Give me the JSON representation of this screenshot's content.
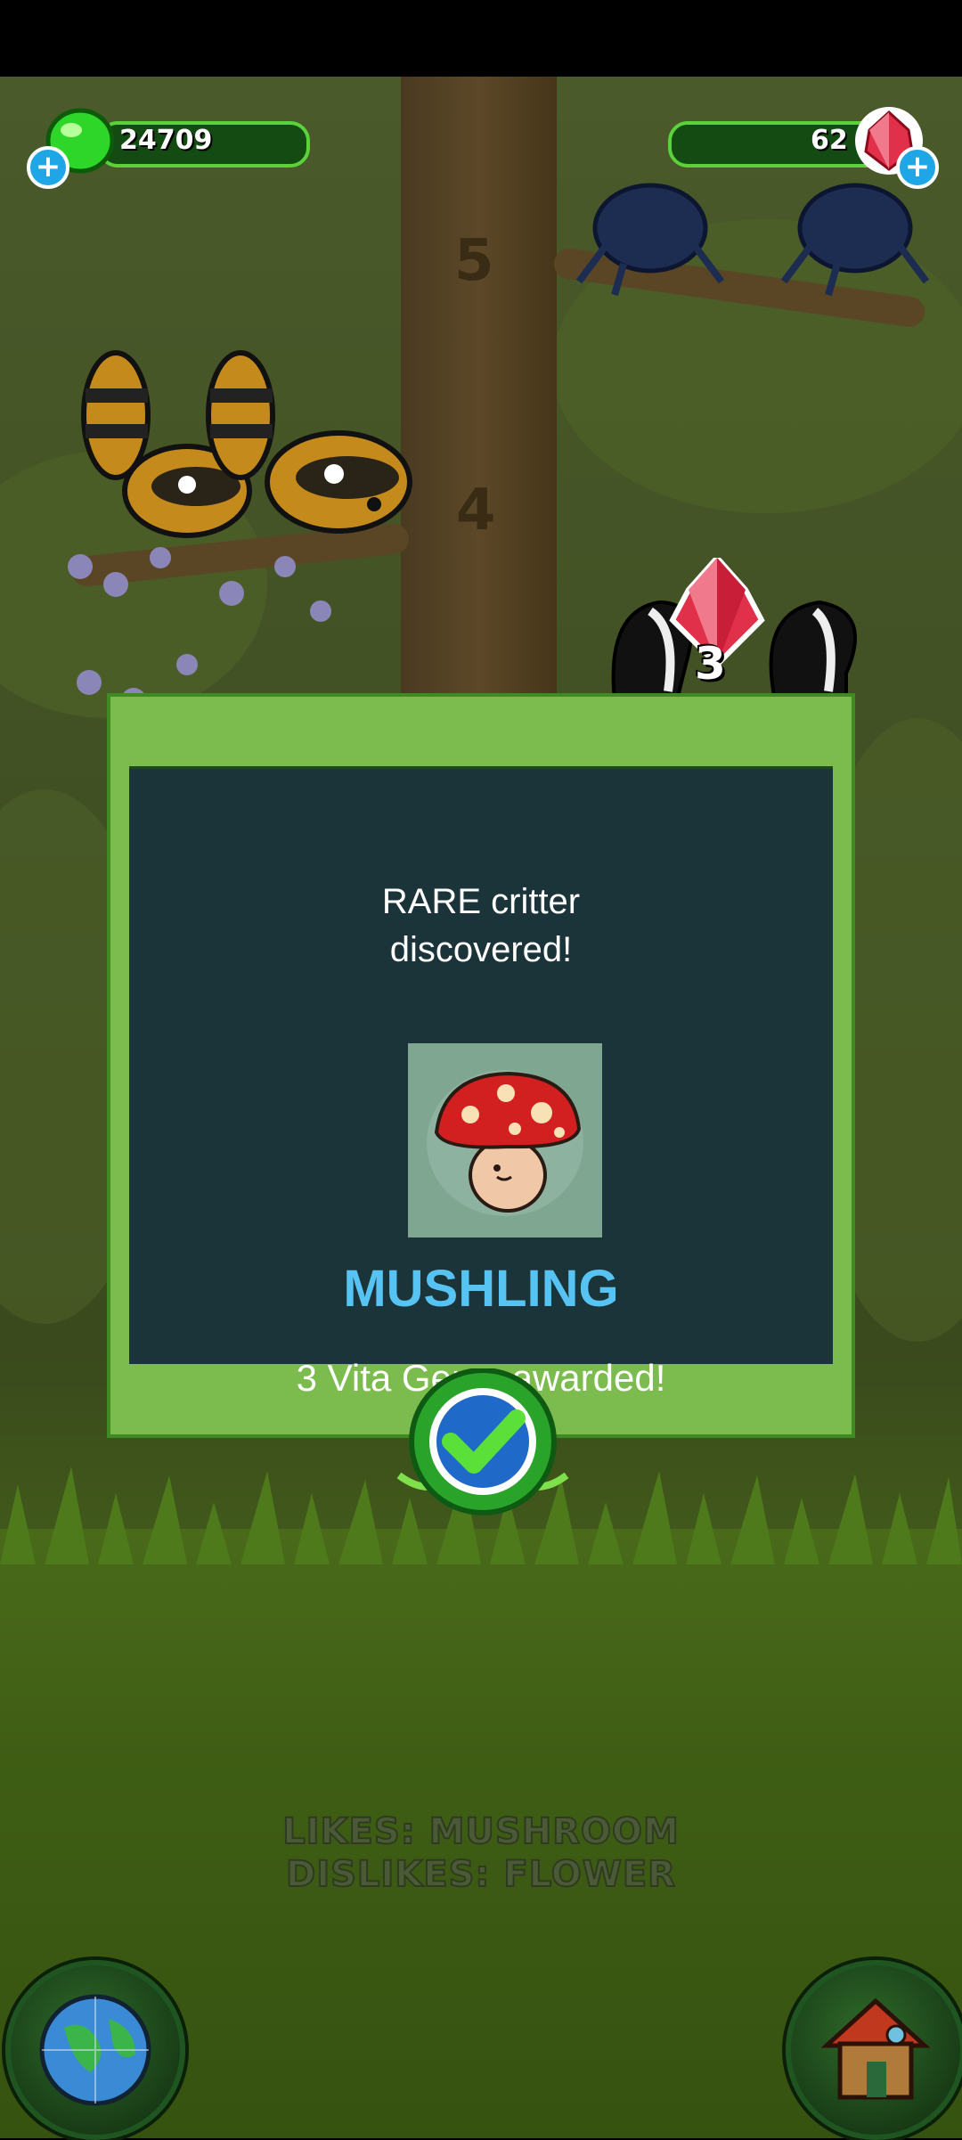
{
  "hud": {
    "left_resource": {
      "value": "24709",
      "icon": "green-gem-icon"
    },
    "right_resource": {
      "value": "62",
      "icon": "red-gem-icon"
    }
  },
  "scene": {
    "trunk_numbers": [
      "5",
      "4"
    ],
    "gem_pickup_count": "3"
  },
  "dialog": {
    "title_line1": "RARE critter",
    "title_line2": "discovered!",
    "critter_name": "MUSHLING",
    "award_text": "3 Vita Gems awarded!"
  },
  "info": {
    "likes": "LIKES: MUSHROOM",
    "dislikes": "DISLIKES: FLOWER"
  },
  "colors": {
    "dialog_frame": "#7cbc4f",
    "dialog_panel": "#1b343a",
    "critter_name": "#57c3f2"
  }
}
